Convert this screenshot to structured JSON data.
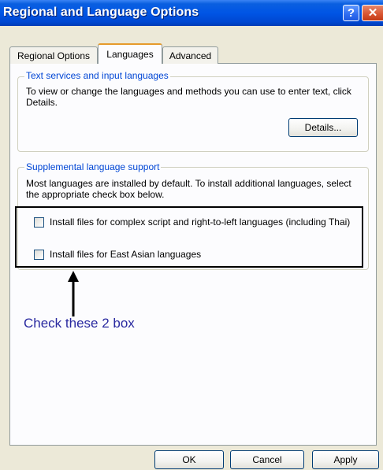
{
  "window": {
    "title": "Regional and Language Options",
    "help_glyph": "?",
    "close_glyph": "✕"
  },
  "tabs": [
    {
      "label": "Regional Options",
      "selected": false
    },
    {
      "label": "Languages",
      "selected": true
    },
    {
      "label": "Advanced",
      "selected": false
    }
  ],
  "text_services": {
    "legend": "Text services and input languages",
    "description": "To view or change the languages and methods you can use to enter text, click Details.",
    "details_label": "Details..."
  },
  "supplemental": {
    "legend": "Supplemental language support",
    "description": "Most languages are installed by default. To install additional languages, select the appropriate check box below.",
    "checkboxes": [
      {
        "label": "Install files for complex script and right-to-left languages (including Thai)",
        "checked": false
      },
      {
        "label": "Install files for East Asian languages",
        "checked": false
      }
    ]
  },
  "annotation": {
    "text": "Check these 2 box",
    "color": "#2a2aa0"
  },
  "footer": {
    "ok_label": "OK",
    "cancel_label": "Cancel",
    "apply_label": "Apply"
  },
  "colors": {
    "title_bar": "#0055e5",
    "dialog_bg": "#ece9d8",
    "legend_text": "#0046d5",
    "selected_tab_accent": "#e69b2b"
  }
}
